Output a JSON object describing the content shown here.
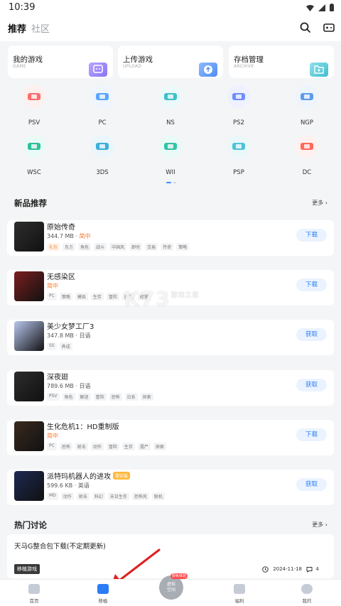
{
  "status": {
    "time": "10:39"
  },
  "header": {
    "tab_active": "推荐",
    "tab_inactive": "社区"
  },
  "quick_actions": [
    {
      "title": "我的游戏",
      "subtitle": "GAME",
      "color": "#c9b9ff"
    },
    {
      "title": "上传游戏",
      "subtitle": "UPLOAD",
      "color": "#9ec3ff"
    },
    {
      "title": "存档管理",
      "subtitle": "ARCHIVE",
      "color": "#9fe0e9"
    }
  ],
  "platforms": [
    {
      "label": "PSV",
      "color": "#ff6b6b",
      "bg": "#fff0f0"
    },
    {
      "label": "PC",
      "color": "#58a6ff",
      "bg": "#eef5ff"
    },
    {
      "label": "NS",
      "color": "#3fc1c9",
      "bg": "#ebf9fa"
    },
    {
      "label": "PS2",
      "color": "#6f8cff",
      "bg": "#eef1ff"
    },
    {
      "label": "NGP",
      "color": "#5f9be8",
      "bg": "#eef4fc"
    },
    {
      "label": "WSC",
      "color": "#2fc09a",
      "bg": "#eafaf5"
    },
    {
      "label": "3DS",
      "color": "#3bb0d9",
      "bg": "#eaf6fb"
    },
    {
      "label": "WII",
      "color": "#34c3a8",
      "bg": "#eafaf6"
    },
    {
      "label": "PSP",
      "color": "#4fc3d6",
      "bg": "#ebf8fa"
    },
    {
      "label": "DC",
      "color": "#ff6a5a",
      "bg": "#fff1ef"
    }
  ],
  "new_section": {
    "title": "新品推荐",
    "more": "更多 ›"
  },
  "games": [
    {
      "name": "原始传奇",
      "size": "344.7 MB",
      "sep": " · ",
      "lang": "简中",
      "lang_warn": true,
      "tags": [
        "礼包",
        "东方",
        "角色",
        "战斗",
        "中国风",
        "即时",
        "交易",
        "传奇",
        "策略"
      ],
      "hot_first": true,
      "action": "下载",
      "cover": "#2e2e2e"
    },
    {
      "name": "无感染区",
      "size": "",
      "sep": "",
      "lang": "简中",
      "lang_warn": true,
      "tags": [
        "PC",
        "策略",
        "模拟",
        "生存",
        "冒险",
        "建造",
        "经营"
      ],
      "hot_first": false,
      "action": "下载",
      "cover": "#7a1f1f"
    },
    {
      "name": "美少女梦工厂3",
      "size": "347.8 MB",
      "sep": " · ",
      "lang": "日语",
      "lang_warn": false,
      "tags": [
        "SS",
        "养成"
      ],
      "hot_first": false,
      "action": "获取",
      "cover": "#b9c8f0"
    },
    {
      "name": "深夜廻",
      "size": "789.6 MB",
      "sep": " · ",
      "lang": "日语",
      "lang_warn": false,
      "tags": [
        "PSV",
        "角色",
        "解谜",
        "冒险",
        "恐怖",
        "日系",
        "探索"
      ],
      "hot_first": false,
      "action": "获取",
      "cover": "#2c2c2c"
    },
    {
      "name": "生化危机1：HD重制版",
      "size": "",
      "sep": "",
      "lang": "简中",
      "lang_warn": true,
      "tags": [
        "PC",
        "恐怖",
        "射击",
        "动作",
        "冒险",
        "生存",
        "僵尸",
        "探索"
      ],
      "hot_first": false,
      "action": "下载",
      "cover": "#3a2a20"
    },
    {
      "name": "派特玛机器人的进攻",
      "badge": "需安装",
      "size": "599.6 KB",
      "sep": " · ",
      "lang": "英语",
      "lang_warn": false,
      "tags": [
        "MD",
        "动作",
        "射击",
        "科幻",
        "末日生存",
        "恐怖风",
        "联机"
      ],
      "hot_first": false,
      "action": "获取",
      "cover": "#1d2a52"
    }
  ],
  "hot_section": {
    "title": "热门讨论",
    "more": "更多 ›"
  },
  "discussion": {
    "title": "天马G整合包下载(不定期更新)",
    "chip": "移植游戏",
    "date": "2024-11-18",
    "comments": "4"
  },
  "watermark": {
    "brand": "K73",
    "cn": "游戏之家",
    "url": ".com"
  },
  "bottom_nav": [
    {
      "label": "首页",
      "active": false
    },
    {
      "label": "移植",
      "active": true
    },
    {
      "label": "福利",
      "active": false
    },
    {
      "label": "我的",
      "active": false
    }
  ],
  "center_button": {
    "line1": "虚拟",
    "line2": "空间",
    "badge": "限免体验"
  },
  "colors": {
    "accent": "#2b7cf5",
    "warn": "#ff7a2a",
    "arrow": "#e02020"
  }
}
